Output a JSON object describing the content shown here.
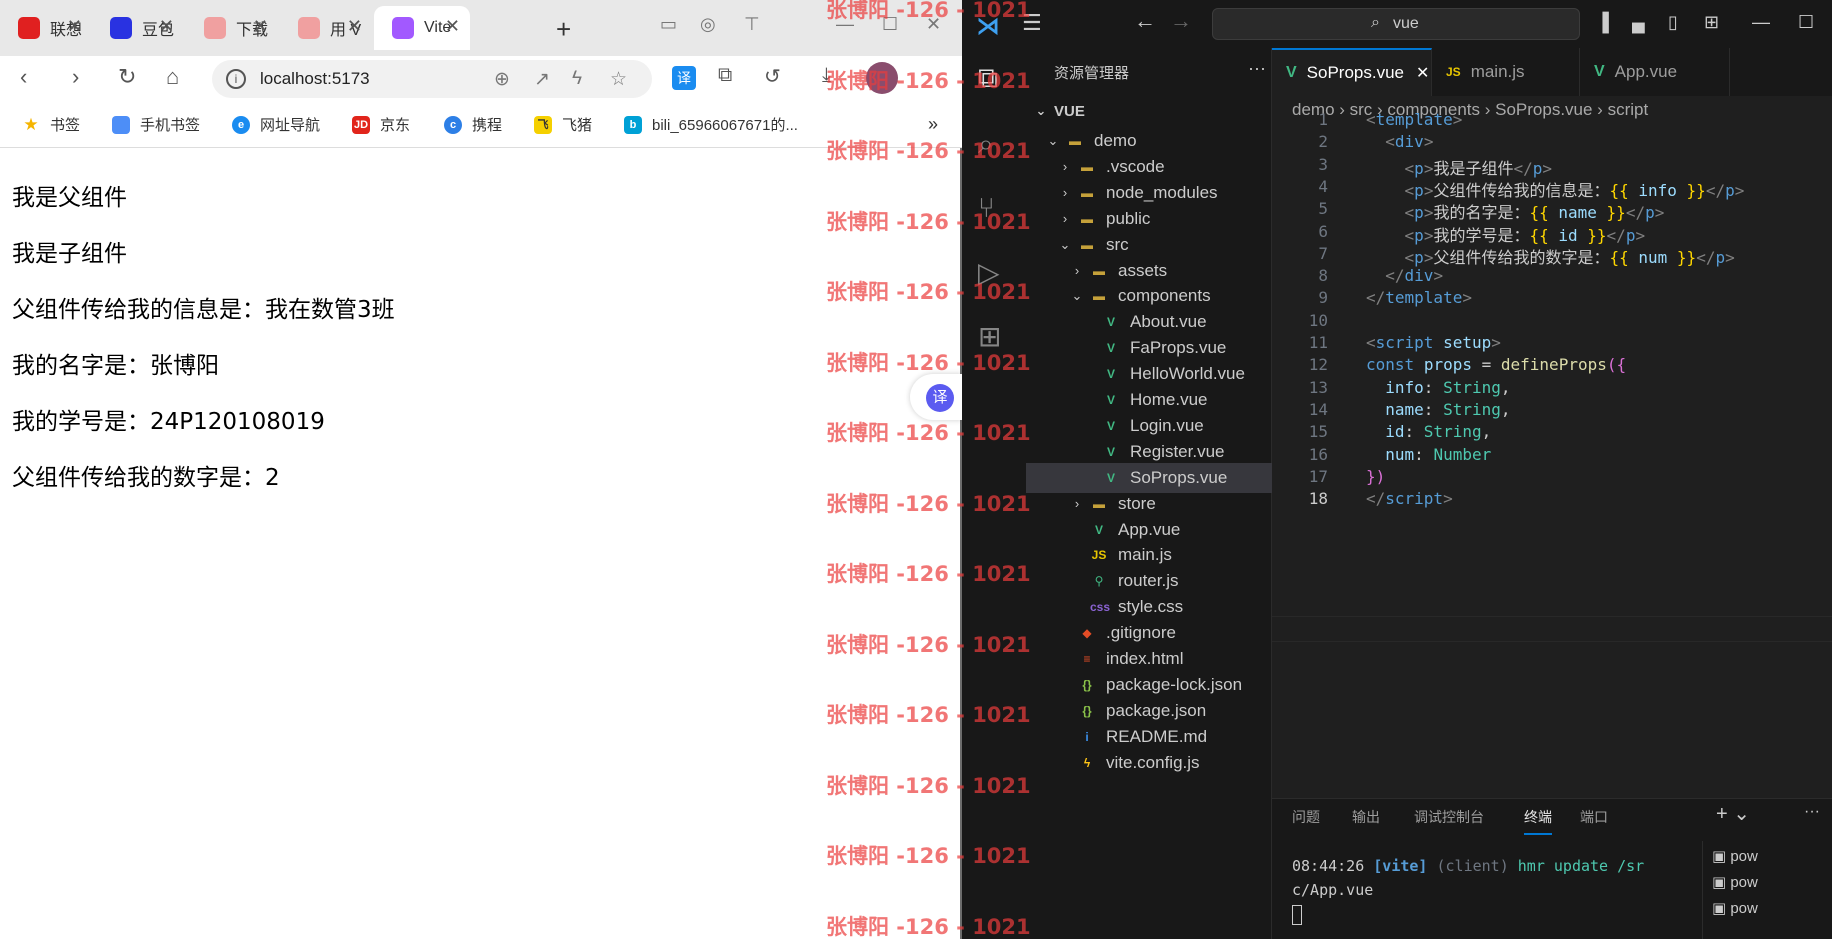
{
  "browser": {
    "tabs": [
      {
        "label": "联想",
        "icon": "lenovo-icon",
        "color": "#e02020"
      },
      {
        "label": "豆包",
        "icon": "baidu-icon",
        "color": "#2932e1"
      },
      {
        "label": "下载",
        "icon": "avatar-icon",
        "color": "#f0a0a0"
      },
      {
        "label": "用 V",
        "icon": "avatar-icon",
        "color": "#f0a0a0"
      },
      {
        "label": "Vite",
        "icon": "vite-icon",
        "color": "#a259ff"
      }
    ],
    "address": "localhost:5173",
    "bookmarks": [
      "书签",
      "手机书签",
      "网址导航",
      "京东",
      "携程",
      "飞猪",
      "bili_65966067671的..."
    ],
    "content_lines": [
      "我是父组件",
      "我是子组件",
      "父组件传给我的信息是：我在数管3班",
      "我的名字是：张博阳",
      "我的学号是：24P120108019",
      "父组件传给我的数字是：2"
    ],
    "translate_label": "译"
  },
  "watermark": "张博阳 -126 - 1021",
  "vscode": {
    "search": "vue",
    "explorer_title": "资源管理器",
    "root": "VUE",
    "tree": [
      {
        "label": "demo",
        "depth": 1,
        "chev": "⌄",
        "icon": "folder-icon"
      },
      {
        "label": ".vscode",
        "depth": 2,
        "chev": "›",
        "icon": "folder-icon"
      },
      {
        "label": "node_modules",
        "depth": 2,
        "chev": "›",
        "icon": "folder-icon"
      },
      {
        "label": "public",
        "depth": 2,
        "chev": "›",
        "icon": "folder-icon"
      },
      {
        "label": "src",
        "depth": 2,
        "chev": "⌄",
        "icon": "folder-icon"
      },
      {
        "label": "assets",
        "depth": 3,
        "chev": "›",
        "icon": "folder-icon"
      },
      {
        "label": "components",
        "depth": 3,
        "chev": "⌄",
        "icon": "folder-icon"
      },
      {
        "label": "About.vue",
        "depth": 4,
        "chev": "",
        "icon": "vue-icon"
      },
      {
        "label": "FaProps.vue",
        "depth": 4,
        "chev": "",
        "icon": "vue-icon"
      },
      {
        "label": "HelloWorld.vue",
        "depth": 4,
        "chev": "",
        "icon": "vue-icon"
      },
      {
        "label": "Home.vue",
        "depth": 4,
        "chev": "",
        "icon": "vue-icon"
      },
      {
        "label": "Login.vue",
        "depth": 4,
        "chev": "",
        "icon": "vue-icon"
      },
      {
        "label": "Register.vue",
        "depth": 4,
        "chev": "",
        "icon": "vue-icon"
      },
      {
        "label": "SoProps.vue",
        "depth": 4,
        "chev": "",
        "icon": "vue-icon",
        "selected": true
      },
      {
        "label": "store",
        "depth": 3,
        "chev": "›",
        "icon": "folder-icon"
      },
      {
        "label": "App.vue",
        "depth": 3,
        "chev": "",
        "icon": "vue-icon"
      },
      {
        "label": "main.js",
        "depth": 3,
        "chev": "",
        "icon": "js-icon"
      },
      {
        "label": "router.js",
        "depth": 3,
        "chev": "",
        "icon": "router-icon"
      },
      {
        "label": "style.css",
        "depth": 3,
        "chev": "",
        "icon": "css-icon"
      },
      {
        "label": ".gitignore",
        "depth": 2,
        "chev": "",
        "icon": "git-icon"
      },
      {
        "label": "index.html",
        "depth": 2,
        "chev": "",
        "icon": "html-icon"
      },
      {
        "label": "package-lock.json",
        "depth": 2,
        "chev": "",
        "icon": "json-icon"
      },
      {
        "label": "package.json",
        "depth": 2,
        "chev": "",
        "icon": "json-icon"
      },
      {
        "label": "README.md",
        "depth": 2,
        "chev": "",
        "icon": "info-icon"
      },
      {
        "label": "vite.config.js",
        "depth": 2,
        "chev": "",
        "icon": "vite-icon"
      }
    ],
    "tabs": [
      {
        "label": "SoProps.vue",
        "icon": "V",
        "active": true
      },
      {
        "label": "main.js",
        "icon": "JS",
        "active": false
      },
      {
        "label": "App.vue",
        "icon": "V",
        "active": false
      }
    ],
    "breadcrumbs": "demo › src › components › SoProps.vue › script",
    "code": [
      "<span class='tg'>&lt;</span><span class='tn'>template</span><span class='tg'>&gt;</span>",
      "  <span class='tg'>&lt;</span><span class='tn'>div</span><span class='tg'>&gt;</span>",
      "    <span class='tg'>&lt;</span><span class='tn'>p</span><span class='tg'>&gt;</span>我是子组件<span class='tg'>&lt;/</span><span class='tn'>p</span><span class='tg'>&gt;</span>",
      "    <span class='tg'>&lt;</span><span class='tn'>p</span><span class='tg'>&gt;</span>父组件传给我的信息是：<span class='br'>{{</span> <span class='vr'>info</span> <span class='br'>}}</span><span class='tg'>&lt;/</span><span class='tn'>p</span><span class='tg'>&gt;</span>",
      "    <span class='tg'>&lt;</span><span class='tn'>p</span><span class='tg'>&gt;</span>我的名字是：<span class='br'>{{</span> <span class='vr'>name</span> <span class='br'>}}</span><span class='tg'>&lt;/</span><span class='tn'>p</span><span class='tg'>&gt;</span>",
      "    <span class='tg'>&lt;</span><span class='tn'>p</span><span class='tg'>&gt;</span>我的学号是：<span class='br'>{{</span> <span class='vr'>id</span> <span class='br'>}}</span><span class='tg'>&lt;/</span><span class='tn'>p</span><span class='tg'>&gt;</span>",
      "    <span class='tg'>&lt;</span><span class='tn'>p</span><span class='tg'>&gt;</span>父组件传给我的数字是：<span class='br'>{{</span> <span class='vr'>num</span> <span class='br'>}}</span><span class='tg'>&lt;/</span><span class='tn'>p</span><span class='tg'>&gt;</span>",
      "  <span class='tg'>&lt;/</span><span class='tn'>div</span><span class='tg'>&gt;</span>",
      "<span class='tg'>&lt;/</span><span class='tn'>template</span><span class='tg'>&gt;</span>",
      "",
      "<span class='tg'>&lt;</span><span class='tn'>script</span> <span class='vr'>setup</span><span class='tg'>&gt;</span>",
      "<span class='kw'>const</span> <span class='vr'>props</span> = <span class='fn'>defineProps</span><span class='pk'>({</span>",
      "  <span class='vr'>info</span>: <span class='ty'>String</span>,",
      "  <span class='vr'>name</span>: <span class='ty'>String</span>,",
      "  <span class='vr'>id</span>: <span class='ty'>String</span>,",
      "  <span class='vr'>num</span>: <span class='ty'>Number</span>",
      "<span class='pk'>})</span>",
      "<span class='tg'>&lt;/</span><span class='tn'>script</span><span class='tg'>&gt;</span>"
    ],
    "panel_tabs": [
      "问题",
      "输出",
      "调试控制台",
      "终端",
      "端口"
    ],
    "active_panel_tab": "终端",
    "terminal_line1_time": "08:44:26",
    "terminal_line1_vite": "[vite]",
    "terminal_line1_client": "(client)",
    "terminal_line1_msg": "hmr update /sr",
    "terminal_line2": "c/App.vue",
    "terminal_list": [
      "pow",
      "pow",
      "pow"
    ]
  }
}
